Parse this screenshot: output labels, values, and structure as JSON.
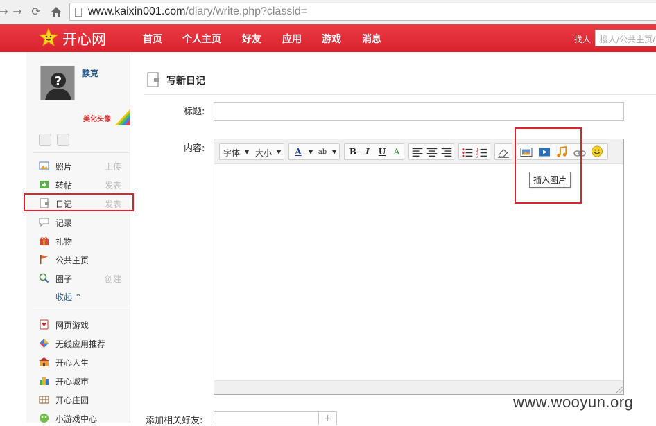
{
  "browser": {
    "url_host": "www.kaixin001.com",
    "url_path": "/diary/write.php?classid="
  },
  "topnav": {
    "logo_text": "开心网",
    "links": [
      "首页",
      "个人主页",
      "好友",
      "应用",
      "游戏",
      "消息"
    ],
    "find_label": "找人",
    "search_placeholder": "搜人/公共主页/"
  },
  "sidebar": {
    "username": "黩克",
    "beautify_label": "美化头像",
    "items": [
      {
        "label": "照片",
        "action": "上传",
        "icon": "photo-icon"
      },
      {
        "label": "转帖",
        "action": "发表",
        "icon": "repost-icon"
      },
      {
        "label": "日记",
        "action": "发表",
        "icon": "diary-icon"
      },
      {
        "label": "记录",
        "action": "",
        "icon": "record-icon"
      },
      {
        "label": "礼物",
        "action": "",
        "icon": "gift-icon"
      },
      {
        "label": "公共主页",
        "action": "",
        "icon": "flag-icon"
      },
      {
        "label": "圈子",
        "action": "创建",
        "icon": "circle-icon"
      }
    ],
    "collapse_label": "收起",
    "apps": [
      {
        "label": "网页游戏",
        "icon": "cards-icon"
      },
      {
        "label": "无线应用推荐",
        "icon": "diamond-icon"
      },
      {
        "label": "开心人生",
        "icon": "life-icon"
      },
      {
        "label": "开心城市",
        "icon": "city-icon"
      },
      {
        "label": "开心庄园",
        "icon": "farm-icon"
      },
      {
        "label": "小游戏中心",
        "icon": "game-icon"
      }
    ]
  },
  "main": {
    "page_title": "写新日记",
    "title_label": "标题:",
    "content_label": "内容:",
    "toolbar": {
      "font_label": "字体",
      "size_label": "大小"
    },
    "tooltip": "插入图片",
    "friends_label": "添加相关好友:",
    "friends_add": "+"
  },
  "watermark": "www.wooyun.org",
  "colors": {
    "nav_red": "#d8222e",
    "highlight_red": "#d9262e",
    "link_blue": "#2b5b8d"
  }
}
